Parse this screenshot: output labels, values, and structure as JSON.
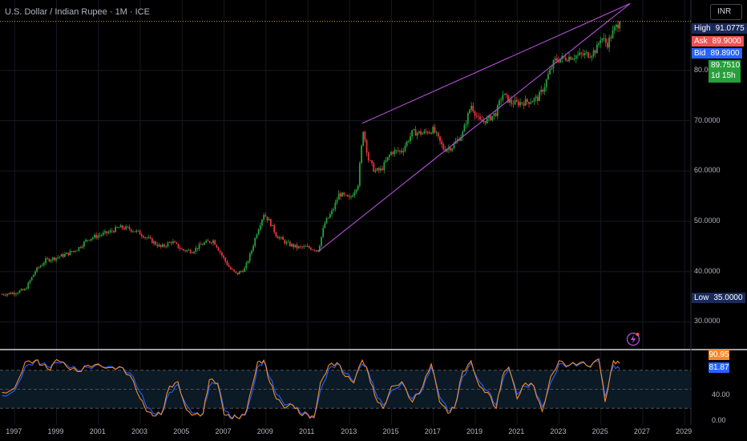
{
  "header": {
    "title": "U.S. Dollar / Indian Rupee · 1M · ICE",
    "currency_button": "INR"
  },
  "price_tags": {
    "high": {
      "label": "High",
      "value": "91.0775",
      "color": "#1a2a5a"
    },
    "ask": {
      "label": "Ask",
      "value": "89.9000",
      "color": "#f05252"
    },
    "bid": {
      "label": "Bid",
      "value": "89.8900",
      "color": "#2962ff"
    },
    "last": {
      "value": "89.7510",
      "countdown": "1d 15h",
      "color": "#26a03b"
    },
    "low": {
      "label": "Low",
      "value": "35.0000",
      "color": "#1a2a5a"
    }
  },
  "oscillator_tags": {
    "k": {
      "value": "90.95",
      "color": "#f28a2c"
    },
    "d": {
      "value": "81.87",
      "color": "#2962ff"
    }
  },
  "chart_data": [
    {
      "type": "candlestick",
      "title": "U.S. Dollar / Indian Rupee · 1M · ICE",
      "x_ticks": [
        "1997",
        "1999",
        "2001",
        "2003",
        "2005",
        "2007",
        "2009",
        "2011",
        "2013",
        "2015",
        "2017",
        "2019",
        "2021",
        "2023",
        "2025",
        "2027",
        "2029"
      ],
      "y_ticks": [
        "30.0000",
        "40.0000",
        "50.0000",
        "60.0000",
        "70.0000",
        "80.0000"
      ],
      "ylim": [
        24.5,
        94
      ],
      "xlim": [
        1996.3,
        2029.3
      ],
      "up_color": "#26a03b",
      "down_color": "#e8333c",
      "last_price": 89.751,
      "series": [
        {
          "name": "USDINR",
          "x": [
            1996.4,
            1997.0,
            1997.5,
            1998.0,
            1998.5,
            1999.0,
            1999.5,
            2000.0,
            2000.5,
            2001.0,
            2001.5,
            2002.0,
            2002.5,
            2003.0,
            2003.5,
            2004.0,
            2004.5,
            2005.0,
            2005.5,
            2006.0,
            2006.5,
            2007.0,
            2007.3,
            2007.6,
            2008.0,
            2008.3,
            2008.6,
            2008.9,
            2009.2,
            2009.5,
            2010.0,
            2010.5,
            2011.0,
            2011.3,
            2011.5,
            2011.8,
            2012.2,
            2012.5,
            2013.0,
            2013.4,
            2013.65,
            2013.9,
            2014.2,
            2014.5,
            2015.0,
            2015.5,
            2016.0,
            2016.5,
            2017.0,
            2017.5,
            2017.9,
            2018.4,
            2018.8,
            2019.2,
            2019.6,
            2020.0,
            2020.3,
            2020.7,
            2021.0,
            2021.5,
            2022.0,
            2022.3,
            2022.5,
            2022.8,
            2023.2,
            2023.6,
            2024.0,
            2024.5,
            2024.8,
            2025.0,
            2025.3,
            2025.6,
            2025.9
          ],
          "close": [
            35.5,
            35.8,
            36.4,
            40.2,
            42.3,
            42.8,
            43.5,
            44.5,
            46.5,
            47.2,
            47.8,
            48.8,
            48.5,
            47.6,
            46.2,
            44.8,
            46.0,
            44.3,
            44.1,
            45.6,
            46.2,
            42.5,
            40.5,
            39.5,
            40.6,
            44.0,
            48.2,
            51.5,
            49.8,
            47.2,
            45.6,
            44.8,
            44.8,
            44.5,
            44.3,
            49.5,
            52.2,
            55.5,
            54.4,
            57.5,
            68.3,
            62.3,
            60.0,
            60.2,
            63.8,
            64.0,
            67.7,
            67.5,
            68.2,
            64.3,
            64.8,
            67.5,
            73.2,
            69.8,
            70.2,
            71.6,
            75.3,
            73.6,
            73.5,
            73.8,
            74.5,
            76.8,
            79.2,
            82.0,
            82.4,
            82.8,
            83.0,
            83.3,
            84.2,
            86.7,
            85.2,
            87.8,
            89.751
          ]
        },
        {
          "name": "Rising wedge upper line",
          "x": [
            2013.6,
            2026.4
          ],
          "close": [
            69.5,
            93.3
          ],
          "color": "#b24fd6"
        },
        {
          "name": "Rising wedge lower line",
          "x": [
            2011.5,
            2026.4
          ],
          "close": [
            44.0,
            93.3
          ],
          "color": "#b24fd6"
        }
      ]
    },
    {
      "type": "line",
      "y_ticks": [
        "40.00",
        "0.00"
      ],
      "ylim": [
        0,
        100
      ],
      "bands": [
        20,
        50,
        80
      ],
      "series": [
        {
          "name": "%K",
          "color": "#f28a2c",
          "x": [
            1996.4,
            1997.0,
            1997.5,
            1998.0,
            1998.3,
            1998.7,
            1999.0,
            1999.5,
            2000.0,
            2000.5,
            2001.0,
            2001.5,
            2002.0,
            2002.5,
            2003.0,
            2003.3,
            2003.6,
            2004.0,
            2004.4,
            2004.8,
            2005.2,
            2005.6,
            2006.0,
            2006.3,
            2006.7,
            2007.0,
            2007.3,
            2007.6,
            2008.0,
            2008.3,
            2008.6,
            2008.9,
            2009.2,
            2009.5,
            2009.9,
            2010.3,
            2010.6,
            2011.0,
            2011.3,
            2011.6,
            2012.0,
            2012.4,
            2012.8,
            2013.2,
            2013.6,
            2013.9,
            2014.2,
            2014.6,
            2015.0,
            2015.5,
            2016.0,
            2016.5,
            2016.9,
            2017.3,
            2017.7,
            2018.0,
            2018.4,
            2018.8,
            2019.2,
            2019.6,
            2020.0,
            2020.3,
            2020.6,
            2021.0,
            2021.4,
            2021.8,
            2022.2,
            2022.6,
            2023.0,
            2023.5,
            2024.0,
            2024.5,
            2024.9,
            2025.2,
            2025.6,
            2025.9
          ],
          "y": [
            45,
            52,
            93,
            96,
            88,
            80,
            97,
            85,
            78,
            88,
            90,
            84,
            86,
            72,
            35,
            15,
            8,
            10,
            55,
            62,
            18,
            10,
            12,
            65,
            58,
            10,
            5,
            6,
            10,
            50,
            93,
            96,
            60,
            35,
            20,
            25,
            12,
            10,
            5,
            60,
            88,
            92,
            70,
            60,
            96,
            74,
            40,
            20,
            55,
            62,
            30,
            55,
            90,
            30,
            12,
            20,
            78,
            95,
            55,
            45,
            20,
            70,
            85,
            35,
            60,
            55,
            15,
            70,
            95,
            88,
            92,
            85,
            98,
            30,
            95,
            90.95
          ]
        },
        {
          "name": "%D",
          "color": "#2962ff",
          "x": [
            1996.4,
            1997.0,
            1997.5,
            1998.0,
            1998.3,
            1998.7,
            1999.0,
            1999.5,
            2000.0,
            2000.5,
            2001.0,
            2001.5,
            2002.0,
            2002.5,
            2003.0,
            2003.3,
            2003.6,
            2004.0,
            2004.4,
            2004.8,
            2005.2,
            2005.6,
            2006.0,
            2006.3,
            2006.7,
            2007.0,
            2007.3,
            2007.6,
            2008.0,
            2008.3,
            2008.6,
            2008.9,
            2009.2,
            2009.5,
            2009.9,
            2010.3,
            2010.6,
            2011.0,
            2011.3,
            2011.6,
            2012.0,
            2012.4,
            2012.8,
            2013.2,
            2013.6,
            2013.9,
            2014.2,
            2014.6,
            2015.0,
            2015.5,
            2016.0,
            2016.5,
            2016.9,
            2017.3,
            2017.7,
            2018.0,
            2018.4,
            2018.8,
            2019.2,
            2019.6,
            2020.0,
            2020.3,
            2020.6,
            2021.0,
            2021.4,
            2021.8,
            2022.2,
            2022.6,
            2023.0,
            2023.5,
            2024.0,
            2024.5,
            2024.9,
            2025.2,
            2025.6,
            2025.9
          ],
          "y": [
            40,
            48,
            85,
            95,
            90,
            84,
            92,
            88,
            80,
            85,
            89,
            86,
            85,
            76,
            45,
            22,
            12,
            10,
            45,
            58,
            25,
            12,
            11,
            55,
            60,
            18,
            7,
            6,
            9,
            40,
            85,
            95,
            68,
            42,
            25,
            24,
            15,
            11,
            7,
            48,
            82,
            90,
            75,
            62,
            90,
            78,
            48,
            25,
            48,
            60,
            35,
            50,
            85,
            38,
            16,
            20,
            70,
            92,
            62,
            48,
            25,
            62,
            82,
            42,
            55,
            56,
            22,
            60,
            90,
            88,
            90,
            86,
            95,
            38,
            88,
            81.87
          ]
        }
      ]
    }
  ]
}
